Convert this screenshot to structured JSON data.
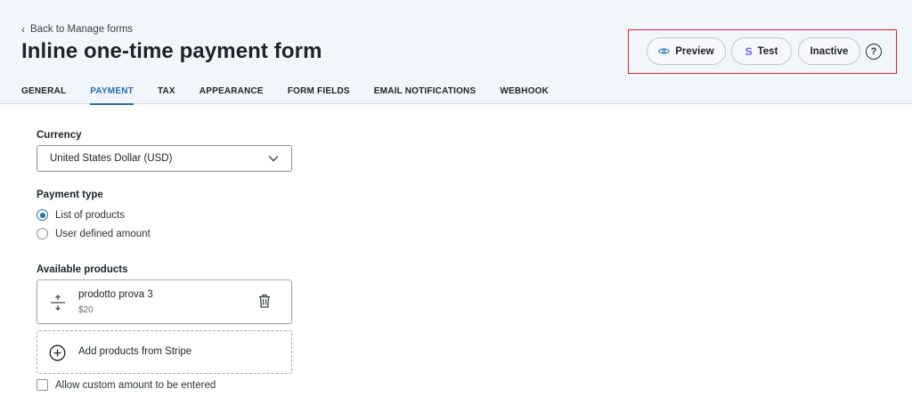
{
  "header": {
    "back_link": "Back to Manage forms",
    "title": "Inline one-time payment form",
    "tabs": [
      {
        "label": "GENERAL"
      },
      {
        "label": "PAYMENT",
        "active": true
      },
      {
        "label": "TAX"
      },
      {
        "label": "APPEARANCE"
      },
      {
        "label": "FORM FIELDS"
      },
      {
        "label": "EMAIL NOTIFICATIONS"
      },
      {
        "label": "WEBHOOK"
      }
    ],
    "actions": {
      "preview_label": "Preview",
      "test_label": "Test",
      "test_icon": "S",
      "inactive_label": "Inactive",
      "help_icon": "?"
    }
  },
  "payment": {
    "currency_label": "Currency",
    "currency_value": "United States Dollar (USD)",
    "payment_type_label": "Payment type",
    "payment_types": [
      {
        "label": "List of products",
        "checked": true
      },
      {
        "label": "User defined amount",
        "checked": false
      }
    ],
    "available_products_label": "Available products",
    "products": [
      {
        "name": "prodotto prova 3",
        "price": "$20"
      }
    ],
    "add_products_label": "Add products from Stripe",
    "custom_amount_label": "Allow custom amount to be entered"
  },
  "colors": {
    "accent": "#2271b1",
    "header_bg": "#f1f5fc",
    "highlight_box": "#e1202c"
  }
}
